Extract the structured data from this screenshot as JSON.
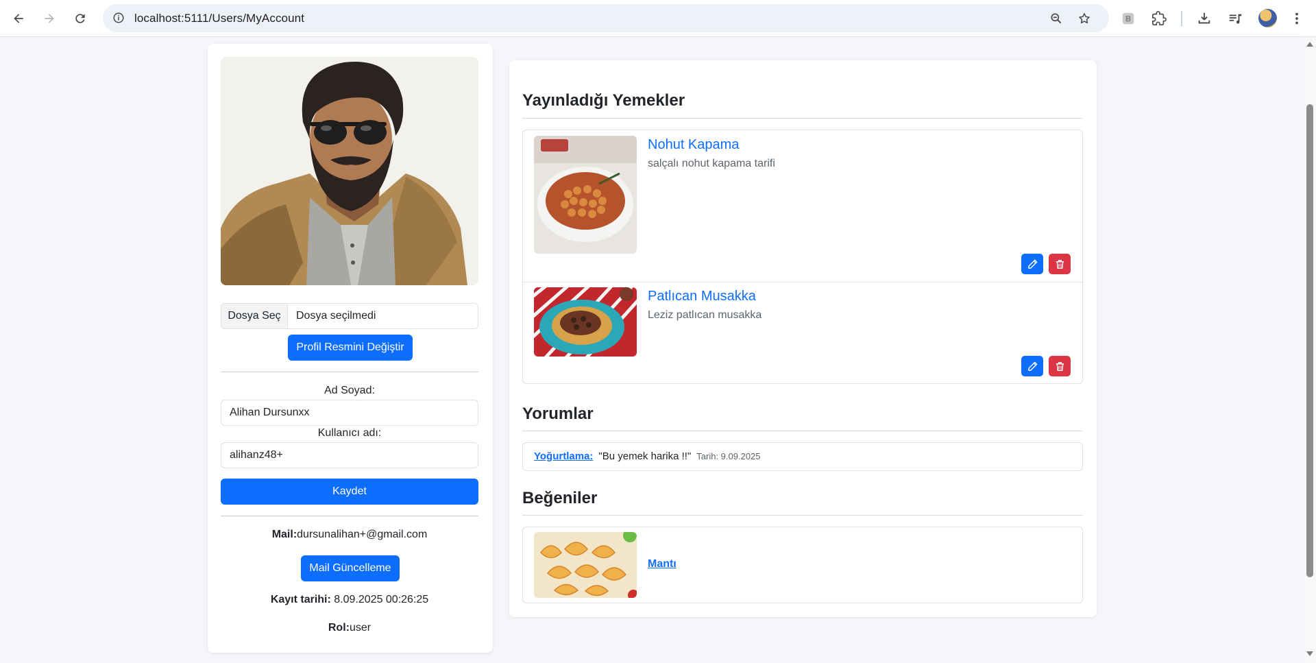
{
  "browser": {
    "url": "localhost:5111/Users/MyAccount"
  },
  "profile": {
    "file_choose_label": "Dosya Seç",
    "file_status": "Dosya seçilmedi",
    "change_photo_button": "Profil Resmini Değiştir",
    "fullname_label": "Ad Soyad:",
    "fullname_value": "Alihan Dursunxx",
    "username_label": "Kullanıcı adı:",
    "username_value": "alihanz48+",
    "save_button": "Kaydet",
    "mail_label": "Mail:",
    "mail_value": "dursunalihan+@gmail.com",
    "mail_update_button": "Mail Güncelleme",
    "registered_label": "Kayıt tarihi:",
    "registered_value": "8.09.2025 00:26:25",
    "role_label": "Rol:",
    "role_value": "user"
  },
  "recipes": {
    "title": "Yayınladığı Yemekler",
    "items": [
      {
        "name": "Nohut Kapama",
        "description": "salçalı nohut kapama tarifi"
      },
      {
        "name": "Patlıcan Musakka",
        "description": "Leziz patlıcan musakka"
      }
    ]
  },
  "comments": {
    "title": "Yorumlar",
    "items": [
      {
        "recipe": "Yoğurtlama:",
        "text": "\"Bu yemek harika !!\"",
        "date": "Tarih: 9.09.2025"
      }
    ]
  },
  "likes": {
    "title": "Beğeniler",
    "items": [
      {
        "name": "Mantı"
      }
    ]
  }
}
